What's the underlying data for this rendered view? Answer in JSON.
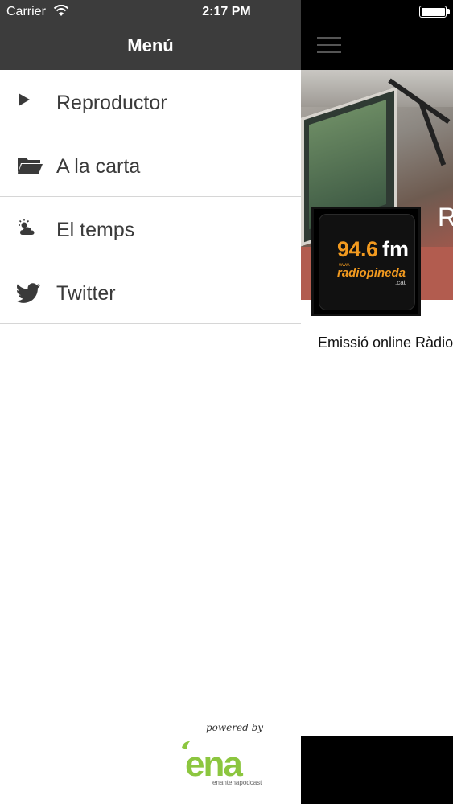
{
  "status_bar": {
    "carrier": "Carrier",
    "time": "2:17 PM",
    "battery_level": 1.0
  },
  "drawer": {
    "title": "Menú",
    "items": [
      {
        "label": "Reproductor",
        "icon": "play-icon"
      },
      {
        "label": "A la carta",
        "icon": "folder-icon"
      },
      {
        "label": "El temps",
        "icon": "weather-icon"
      },
      {
        "label": "Twitter",
        "icon": "twitter-icon"
      }
    ],
    "footer": {
      "powered_by": "powered by",
      "brand": "ena",
      "brand_sub": "enantenapodcast"
    }
  },
  "app": {
    "station_logo": {
      "frequency": "94.6",
      "unit": "fm",
      "www": "www.",
      "name": "radiopineda",
      "tld": ".cat"
    },
    "station_initial": "R",
    "description": "Emissió online Ràdio"
  },
  "colors": {
    "header_bg": "#3c3c3c",
    "logo_orange": "#f29a1f",
    "ena_green": "#8cc63f"
  }
}
